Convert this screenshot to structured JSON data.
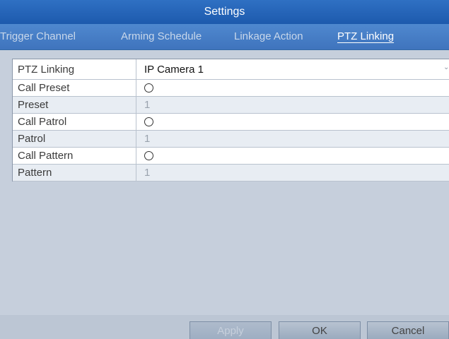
{
  "window": {
    "title": "Settings"
  },
  "tabs": [
    {
      "label": "Trigger Channel",
      "active": false
    },
    {
      "label": "Arming Schedule",
      "active": false
    },
    {
      "label": "Linkage Action",
      "active": false
    },
    {
      "label": "PTZ Linking",
      "active": true
    }
  ],
  "form": {
    "ptz_linking": {
      "label": "PTZ Linking",
      "value": "IP Camera 1",
      "icon": "chevron-down-icon"
    },
    "rows": [
      {
        "label": "Call Preset",
        "type": "radio",
        "value": ""
      },
      {
        "label": "Preset",
        "type": "text",
        "value": "1"
      },
      {
        "label": "Call Patrol",
        "type": "radio",
        "value": ""
      },
      {
        "label": "Patrol",
        "type": "text",
        "value": "1"
      },
      {
        "label": "Call Pattern",
        "type": "radio",
        "value": ""
      },
      {
        "label": "Pattern",
        "type": "text",
        "value": "1"
      }
    ]
  },
  "buttons": {
    "apply": "Apply",
    "ok": "OK",
    "cancel": "Cancel"
  },
  "colors": {
    "title_bar": "#1f5fb1",
    "tab_bar": "#3f74bd",
    "panel": "#c6cfdc",
    "alternate_row": "#e8edf3"
  }
}
